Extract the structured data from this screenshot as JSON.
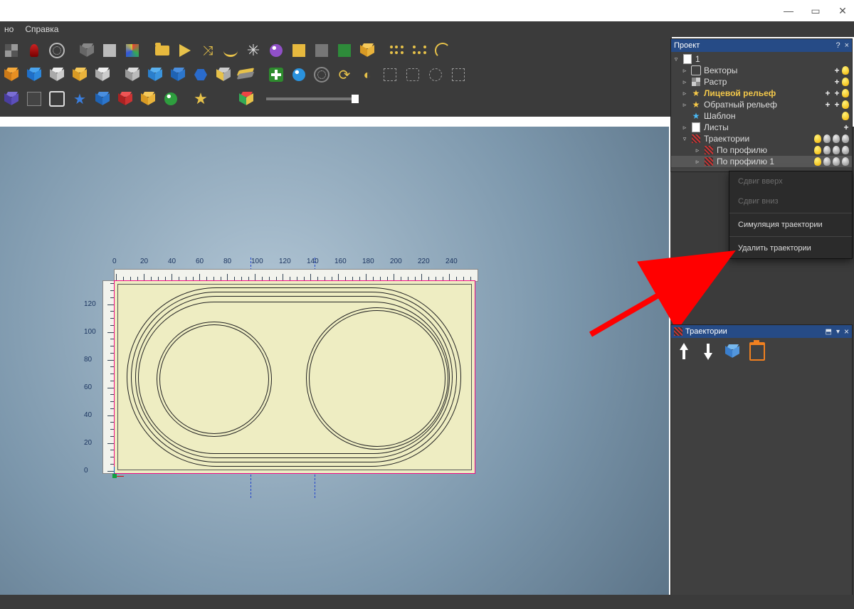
{
  "window_controls": {
    "min": "—",
    "max": "▭",
    "close": "✕"
  },
  "menubar": [
    "но",
    "Справка"
  ],
  "ruler": {
    "x": [
      "0",
      "20",
      "40",
      "60",
      "80",
      "100",
      "120",
      "140",
      "160",
      "180",
      "200",
      "220",
      "240"
    ],
    "y": [
      "0",
      "20",
      "40",
      "60",
      "80",
      "100",
      "120"
    ]
  },
  "project_panel": {
    "title": "Проект",
    "root": "1",
    "items": [
      {
        "arrow": "▹",
        "icon": "vectors",
        "label": "Векторы",
        "tail": [
          "plus",
          "bulb"
        ]
      },
      {
        "arrow": "▹",
        "icon": "raster",
        "label": "Растр",
        "tail": [
          "plus",
          "bulb"
        ]
      },
      {
        "arrow": "▹",
        "icon": "star",
        "label": "Лицевой рельеф",
        "gold": true,
        "tail": [
          "plus",
          "plus",
          "bulb"
        ]
      },
      {
        "arrow": "▹",
        "icon": "star",
        "label": "Обратный рельеф",
        "tail": [
          "plus",
          "plus",
          "bulb"
        ]
      },
      {
        "arrow": "",
        "icon": "star-blue",
        "label": "Шаблон",
        "tail": [
          "bulb"
        ]
      },
      {
        "arrow": "▹",
        "icon": "sheets",
        "label": "Листы",
        "tail": [
          "plus"
        ]
      },
      {
        "arrow": "▿",
        "icon": "traj",
        "label": "Траектории",
        "tail": [
          "bulb",
          "gray",
          "gray",
          "gray"
        ]
      },
      {
        "arrow": "▹",
        "icon": "diag",
        "label": "По профилю",
        "indent": 1,
        "tail": [
          "bulb",
          "gray",
          "gray",
          "gray"
        ]
      },
      {
        "arrow": "▹",
        "icon": "diag",
        "label": "По профилю 1",
        "indent": 1,
        "sel": true,
        "tail": [
          "bulb",
          "gray",
          "gray",
          "gray"
        ]
      }
    ]
  },
  "context_menu": {
    "items": [
      "Сдвиг вверх",
      "Сдвиг вниз",
      "Симуляция траектории",
      "Удалить траектории"
    ],
    "disabled": [
      0,
      1
    ]
  },
  "traj_panel": {
    "title": "Траектории"
  },
  "panel_help": "?",
  "panel_close": "×"
}
